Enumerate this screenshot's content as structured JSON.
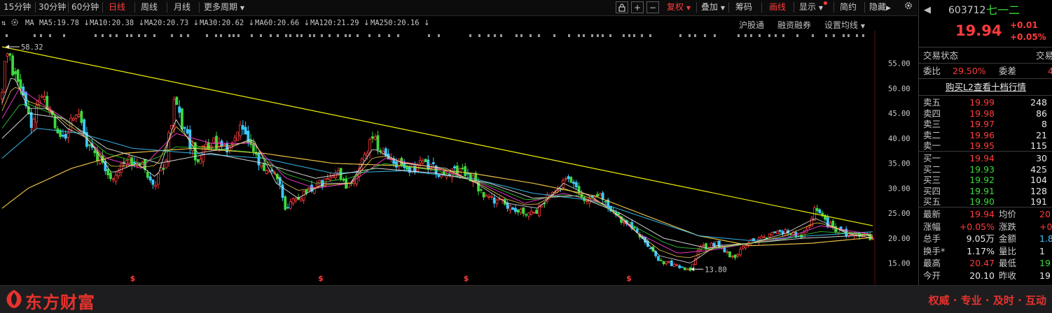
{
  "toolbar": {
    "periods": [
      "15分钟",
      "30分钟",
      "60分钟",
      "日线",
      "周线",
      "月线",
      "更多周期"
    ],
    "active_period": "日线",
    "more_arrow": "▼",
    "tool_plus": "+",
    "tool_minus": "−",
    "fuquan": "复权",
    "diejia": "叠加",
    "chouma": "筹码",
    "huaxian": "画线",
    "xianshi": "显示",
    "jiancao": "简约",
    "yincang": "隐藏",
    "play": "▶",
    "dropdown_arrow": "▼"
  },
  "ma_bar": {
    "label": "MA",
    "items": [
      {
        "text": "MA5:19.78",
        "arrow": "↓",
        "color": "#e8e8e8"
      },
      {
        "text": "MA10:20.38",
        "arrow": "↓",
        "color": "#ffd24a"
      },
      {
        "text": "MA20:20.73",
        "arrow": "↓",
        "color": "#ff3bd8"
      },
      {
        "text": "MA30:20.62",
        "arrow": "↓",
        "color": "#3cd83c"
      },
      {
        "text": "MA60:20.66",
        "arrow": "↓",
        "color": "#e8e8e8"
      },
      {
        "text": "MA120:21.29",
        "arrow": "↓",
        "color": "#3cc8ff"
      },
      {
        "text": "MA250:20.16",
        "arrow": "↓",
        "color": "#ffd24a"
      }
    ],
    "hugutong": "沪股通",
    "rongzi": "融资融券",
    "shezhi": "设置均线",
    "shezhi_arrow": "▼"
  },
  "chart_data": {
    "type": "candlestick",
    "y_ticks": [
      "55.00",
      "50.00",
      "45.00",
      "40.00",
      "35.00",
      "30.00",
      "25.00",
      "20.00",
      "15.00"
    ],
    "ylim": [
      13.0,
      58.6
    ],
    "high_label": "58.32",
    "low_label": "13.80",
    "event_marker": "$",
    "price_path": [
      [
        0,
        48
      ],
      [
        0.4,
        58.32
      ],
      [
        1.5,
        52
      ],
      [
        2.6,
        47
      ],
      [
        3.4,
        43
      ],
      [
        4.5,
        49
      ],
      [
        5.8,
        44
      ],
      [
        7.2,
        40
      ],
      [
        8.6,
        46
      ],
      [
        9.8,
        38
      ],
      [
        11.2,
        36
      ],
      [
        12.5,
        31
      ],
      [
        13.8,
        35
      ],
      [
        15.5,
        36
      ],
      [
        17.5,
        30
      ],
      [
        18.8,
        36
      ],
      [
        19.8,
        48
      ],
      [
        20.8,
        42
      ],
      [
        22.4,
        36
      ],
      [
        24.0,
        39
      ],
      [
        25.8,
        38
      ],
      [
        27.6,
        43
      ],
      [
        28.8,
        38
      ],
      [
        30.2,
        33
      ],
      [
        31.3,
        34
      ],
      [
        32.6,
        26
      ],
      [
        34.1,
        28
      ],
      [
        35.6,
        30
      ],
      [
        36.9,
        31
      ],
      [
        38.4,
        33
      ],
      [
        40.0,
        30
      ],
      [
        41.2,
        35
      ],
      [
        42.6,
        40
      ],
      [
        43.9,
        37
      ],
      [
        45.4,
        35
      ],
      [
        47.0,
        34
      ],
      [
        48.6,
        35
      ],
      [
        50.5,
        33
      ],
      [
        52.4,
        34
      ],
      [
        54.1,
        32
      ],
      [
        55.6,
        28
      ],
      [
        57.5,
        27
      ],
      [
        59.5,
        25
      ],
      [
        61.6,
        25.5
      ],
      [
        63.5,
        30
      ],
      [
        65.0,
        32
      ],
      [
        66.9,
        28
      ],
      [
        68.5,
        29
      ],
      [
        70.0,
        26
      ],
      [
        71.6,
        23
      ],
      [
        73.6,
        20
      ],
      [
        75.5,
        15.5
      ],
      [
        77.6,
        14.5
      ],
      [
        79.1,
        13.8
      ],
      [
        80.1,
        18
      ],
      [
        82.0,
        19
      ],
      [
        84.0,
        16
      ],
      [
        86.0,
        19.5
      ],
      [
        88.0,
        20.5
      ],
      [
        90.0,
        21.5
      ],
      [
        92.0,
        20
      ],
      [
        93.4,
        26
      ],
      [
        95.0,
        22.5
      ],
      [
        97.0,
        21
      ],
      [
        98.9,
        20.5
      ],
      [
        100,
        19.94
      ]
    ],
    "ma5_path": [
      [
        0,
        47
      ],
      [
        1.2,
        53
      ],
      [
        3,
        46
      ],
      [
        5.2,
        46
      ],
      [
        7.5,
        42
      ],
      [
        9.8,
        40
      ],
      [
        12.6,
        33
      ],
      [
        15.5,
        35
      ],
      [
        17.8,
        32
      ],
      [
        19.9,
        44
      ],
      [
        22.4,
        37
      ],
      [
        26,
        38
      ],
      [
        28.8,
        40
      ],
      [
        31.5,
        31
      ],
      [
        34,
        28
      ],
      [
        37,
        31
      ],
      [
        40,
        31
      ],
      [
        42.6,
        38
      ],
      [
        46,
        35
      ],
      [
        51,
        34
      ],
      [
        54.5,
        31
      ],
      [
        58,
        27
      ],
      [
        61.6,
        26
      ],
      [
        64.5,
        31
      ],
      [
        68,
        28
      ],
      [
        71.6,
        23.5
      ],
      [
        75.5,
        16.5
      ],
      [
        79.1,
        15
      ],
      [
        82,
        18.5
      ],
      [
        86,
        19
      ],
      [
        90,
        21
      ],
      [
        93.4,
        24
      ],
      [
        97,
        21
      ],
      [
        100,
        20
      ]
    ],
    "ma20_path": [
      [
        0,
        44
      ],
      [
        2,
        50
      ],
      [
        4.5,
        47
      ],
      [
        8,
        43
      ],
      [
        12,
        36
      ],
      [
        16,
        34
      ],
      [
        19.9,
        41
      ],
      [
        24,
        39
      ],
      [
        28.8,
        39
      ],
      [
        32.6,
        32
      ],
      [
        36,
        30
      ],
      [
        40,
        31
      ],
      [
        44,
        36
      ],
      [
        50,
        34
      ],
      [
        55,
        31
      ],
      [
        60,
        27
      ],
      [
        64.5,
        29
      ],
      [
        69,
        27
      ],
      [
        73,
        21
      ],
      [
        77.6,
        17
      ],
      [
        81,
        17.5
      ],
      [
        86,
        19
      ],
      [
        90,
        20
      ],
      [
        94,
        22.5
      ],
      [
        100,
        20.7
      ]
    ],
    "ma60_path": [
      [
        0,
        40
      ],
      [
        3,
        45
      ],
      [
        7,
        44
      ],
      [
        12,
        38
      ],
      [
        18,
        35
      ],
      [
        24,
        37
      ],
      [
        30,
        35
      ],
      [
        36,
        32
      ],
      [
        43,
        34
      ],
      [
        50,
        33
      ],
      [
        56,
        31
      ],
      [
        61,
        28
      ],
      [
        66,
        28.5
      ],
      [
        71,
        25
      ],
      [
        76,
        20
      ],
      [
        81,
        18
      ],
      [
        86,
        19
      ],
      [
        92,
        20
      ],
      [
        100,
        20.66
      ]
    ],
    "ma120_path": [
      [
        0,
        36
      ],
      [
        4,
        42
      ],
      [
        9,
        41
      ],
      [
        15,
        38
      ],
      [
        22,
        37
      ],
      [
        30,
        36
      ],
      [
        38,
        33
      ],
      [
        46,
        33.5
      ],
      [
        54,
        32
      ],
      [
        61,
        29
      ],
      [
        68,
        27.5
      ],
      [
        74,
        24
      ],
      [
        80,
        20.5
      ],
      [
        86,
        19.5
      ],
      [
        93,
        20.5
      ],
      [
        100,
        21.29
      ]
    ],
    "ma250_path": [
      [
        0,
        26
      ],
      [
        3,
        30
      ],
      [
        8,
        34
      ],
      [
        14,
        37
      ],
      [
        22,
        38
      ],
      [
        30,
        37
      ],
      [
        38,
        35
      ],
      [
        46,
        34.5
      ],
      [
        54,
        33
      ],
      [
        61,
        31
      ],
      [
        68,
        28.5
      ],
      [
        74,
        24.5
      ],
      [
        80,
        20.5
      ],
      [
        86,
        18.5
      ],
      [
        93,
        19
      ],
      [
        100,
        20.16
      ]
    ],
    "trendline": [
      [
        0,
        58.32
      ],
      [
        100,
        22.5
      ]
    ],
    "marker_x": [
      15,
      36.6,
      53.3,
      72.0
    ]
  },
  "stock": {
    "code": "603712",
    "name": "七一二",
    "price": "19.94",
    "change": "+0.01",
    "change_pct": "+0.05%"
  },
  "status": {
    "label": "交易状态",
    "right": "交易"
  },
  "weibi": {
    "label": "委比",
    "value": "29.50%",
    "label2": "委差",
    "value2": "4"
  },
  "l2_link": "购买L2查看十档行情",
  "order_book": {
    "sell": [
      {
        "label": "卖五",
        "price": "19.99",
        "vol": "248"
      },
      {
        "label": "卖四",
        "price": "19.98",
        "vol": "86"
      },
      {
        "label": "卖三",
        "price": "19.97",
        "vol": "8"
      },
      {
        "label": "卖二",
        "price": "19.96",
        "vol": "21"
      },
      {
        "label": "卖一",
        "price": "19.95",
        "vol": "115"
      }
    ],
    "buy": [
      {
        "label": "买一",
        "price": "19.94",
        "vol": "30"
      },
      {
        "label": "买二",
        "price": "19.93",
        "vol": "425"
      },
      {
        "label": "买三",
        "price": "19.92",
        "vol": "104"
      },
      {
        "label": "买四",
        "price": "19.91",
        "vol": "128"
      },
      {
        "label": "买五",
        "price": "19.90",
        "vol": "191"
      }
    ]
  },
  "stats": [
    {
      "l1": "最新",
      "v1": "19.94",
      "c1": "#ff3b3b",
      "l2": "均价",
      "v2": "20",
      "c2": "#ff3b3b"
    },
    {
      "l1": "涨幅",
      "v1": "+0.05%",
      "c1": "#ff3b3b",
      "l2": "涨跌",
      "v2": "+0",
      "c2": "#ff3b3b"
    },
    {
      "l1": "总手",
      "v1": "9.05万",
      "c1": "#e8e8e8",
      "l2": "金额",
      "v2": "1.8",
      "c2": "#3cc8ff"
    },
    {
      "l1": "换手*",
      "v1": "1.17%",
      "c1": "#e8e8e8",
      "l2": "量比",
      "v2": "1",
      "c2": "#e8e8e8"
    },
    {
      "l1": "最高",
      "v1": "20.47",
      "c1": "#ff3b3b",
      "l2": "最低",
      "v2": "19",
      "c2": "#3cd83c"
    },
    {
      "l1": "今开",
      "v1": "20.10",
      "c1": "#e8e8e8",
      "l2": "昨收",
      "v2": "19",
      "c2": "#e8e8e8"
    }
  ],
  "bottom": {
    "brand": "东方财富",
    "slogan": "权威 · 专业 · 及时 · 互动"
  },
  "colors": {
    "up": "#ff3b3b",
    "down": "#3cd83c",
    "accent_red": "#e8322e",
    "cyan_candle": "#3cc8ff",
    "trendline": "#f0f000"
  }
}
